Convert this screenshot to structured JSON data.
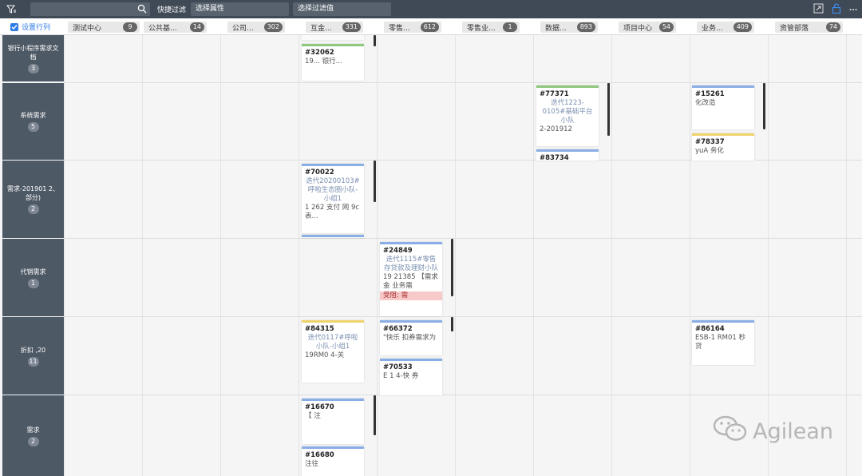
{
  "toolbar": {
    "quick_filter_label": "快捷过滤",
    "select_attr_placeholder": "选择属性",
    "select_value_placeholder": "选择过滤值"
  },
  "header": {
    "set_columns_label": "设置行列",
    "columns": [
      {
        "label": "测试中心",
        "count": "9"
      },
      {
        "label": "公共基...",
        "count": "14"
      },
      {
        "label": "公司...",
        "count": "302"
      },
      {
        "label": "互金...",
        "count": "331"
      },
      {
        "label": "零售...",
        "count": "612"
      },
      {
        "label": "零售业...",
        "count": "1"
      },
      {
        "label": "数据...",
        "count": "893"
      },
      {
        "label": "项目中心",
        "count": "54"
      },
      {
        "label": "业务...",
        "count": "409"
      },
      {
        "label": "资管部落",
        "count": "74"
      }
    ]
  },
  "rows": [
    {
      "label": "银行小程序需求文档",
      "count": "3"
    },
    {
      "label": "系统需求",
      "count": "5"
    },
    {
      "label": "需求-201901 2、部分)",
      "count": "2"
    },
    {
      "label": "代销需求",
      "count": "1"
    },
    {
      "label": "折扣 ,20",
      "count": "11"
    },
    {
      "label": "需求",
      "count": "2"
    }
  ],
  "cards": {
    "c1": {
      "id": "#32062",
      "iter": "",
      "desc": "19... 银行..."
    },
    "c2": {
      "id": "#77371",
      "iter": "迭代1223-0105#基础平台小队",
      "desc": "2-201912"
    },
    "c3": {
      "id": "#83734",
      "iter": "",
      "desc": ""
    },
    "c4": {
      "id": "#15261",
      "iter": "",
      "desc": "化改造"
    },
    "c5": {
      "id": "#78337",
      "iter": "",
      "desc": "yuA 务化"
    },
    "c6": {
      "id": "#70022",
      "iter": "迭代20200103#呼啦生态圈小队-小组1",
      "desc": "1 262 支付 网 9c 表..."
    },
    "c7": {
      "id": "#24849",
      "iter": "迭代1115#零售存贷款及理财小队",
      "desc": "19 21385 【需求 金 业务需"
    },
    "c7_block": "受阻: 需",
    "c8": {
      "id": "#84315",
      "iter": "迭代0117#呼啦小队-小组1",
      "desc": "19RM0 4-关"
    },
    "c9": {
      "id": "#66372",
      "iter": "",
      "desc": "\"快乐 扣券需求为"
    },
    "c10": {
      "id": "#70533",
      "iter": "",
      "desc": "E 1 4-快 券"
    },
    "c11": {
      "id": "#86164",
      "iter": "",
      "desc": "ESB-1 RM01 秒 贷"
    },
    "c12": {
      "id": "#16670",
      "iter": "",
      "desc": "【 注"
    },
    "c13": {
      "id": "#16680",
      "iter": "",
      "desc": "注往"
    }
  },
  "watermark": "Agilean"
}
